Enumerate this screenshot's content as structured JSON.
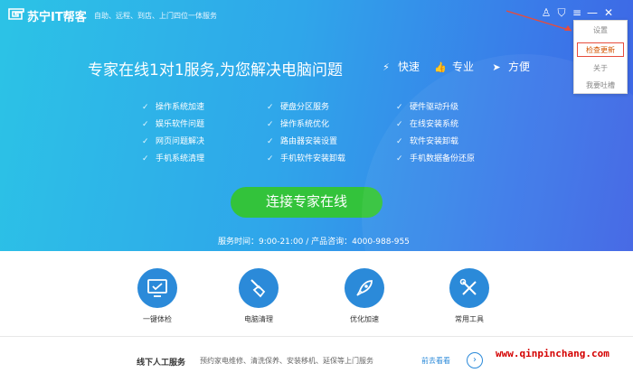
{
  "header": {
    "brand": "苏宁IT帮客",
    "slogan": "自助、远程、到店、上门四位一体服务"
  },
  "window_controls": [
    {
      "name": "user-icon",
      "glyph": "♙"
    },
    {
      "name": "shirt-icon",
      "glyph": "⛉"
    },
    {
      "name": "menu-icon",
      "glyph": "≡"
    },
    {
      "name": "minimize-icon",
      "glyph": "—"
    },
    {
      "name": "close-icon",
      "glyph": "✕"
    }
  ],
  "menu": {
    "items": [
      "设置",
      "检查更新",
      "关于",
      "我要吐槽"
    ],
    "active_index": 1
  },
  "hero": {
    "headline": "专家在线1对1服务,为您解决电脑问题",
    "features": [
      "快速",
      "专业",
      "方便"
    ]
  },
  "services": {
    "col1": [
      "操作系统加速",
      "娱乐软件问题",
      "网页问题解决",
      "手机系统清理"
    ],
    "col2": [
      "硬盘分区服务",
      "操作系统优化",
      "路由器安装设置",
      "手机软件安装卸载"
    ],
    "col3": [
      "硬件驱动升级",
      "在线安装系统",
      "软件安装卸载",
      "手机数据备份还原"
    ]
  },
  "cta": {
    "label": "连接专家在线"
  },
  "hours": {
    "text": "服务时间：9:00-21:00 / 产品咨询：4000-988-955"
  },
  "tools": [
    {
      "label": "一键体检",
      "icon": "monitor-check-icon"
    },
    {
      "label": "电脑清理",
      "icon": "broom-icon"
    },
    {
      "label": "优化加速",
      "icon": "rocket-icon"
    },
    {
      "label": "常用工具",
      "icon": "tools-icon"
    }
  ],
  "offline": {
    "title": "线下人工服务",
    "desc": "预约家电维修、清洗保养、安装移机、延保等上门服务",
    "link": "前去看看"
  },
  "watermark": "www.qinpinchang.com",
  "colors": {
    "hero_start": "#2cc3e6",
    "hero_end": "#3f63e4",
    "cta_green": "#33c33b",
    "tool_blue": "#2b8ad9",
    "annotation_red": "#e74c3c"
  }
}
